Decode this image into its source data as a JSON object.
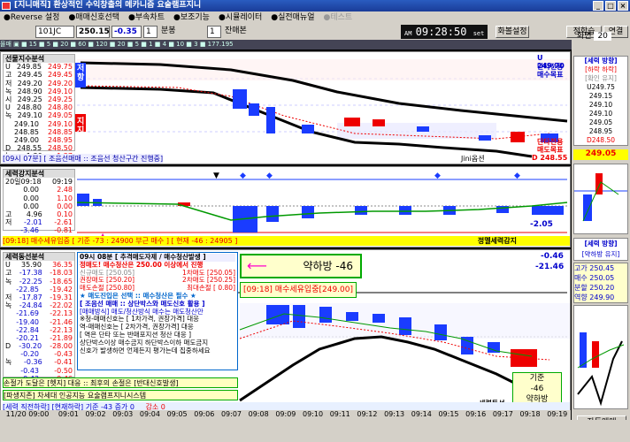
{
  "window": {
    "title": "[지니매직] 환상적인 수익창출의 메카니즘 요술램프지니",
    "min": "_",
    "max": "□",
    "close": "×"
  },
  "menu": [
    "●Reverse 설정",
    "●매매신호선택",
    "●부속차트",
    "●보조기능",
    "●시뮬레이터",
    "●실전매뉴얼",
    "●테스트"
  ],
  "toolbar": {
    "code": "101JC",
    "price": "250.15",
    "change": "-0.35",
    "period_num": "1",
    "period_unit": "분봉",
    "count": "1",
    "count_label": "잔매본",
    "clock": "09:28:50",
    "clock_suffix": "set",
    "btn_shrink": "화볼설정",
    "btn_watch": "정학습",
    "btn_link": "연결",
    "screen_label": "화면",
    "screen_num": "20"
  },
  "toolbar2": "몰매 ▣ ■ 15 ■ 5 ■ 20 ■ 60 ■ 120 ■ 20 ■ 5 ■ 1 ■ 4 ■ 10 ■ 3 ■ 177.195",
  "panel1": {
    "title": "선물지수분석",
    "rows": [
      [
        "U",
        "249.85",
        "249.75"
      ],
      [
        "고",
        "249.45",
        "249.45"
      ],
      [
        "저",
        "249.20",
        "249.20"
      ],
      [
        "녹",
        "248.90",
        "249.10"
      ],
      [
        "시",
        "249.25",
        "249.25"
      ],
      [
        "U",
        "248.80",
        "248.80"
      ],
      [
        "녹",
        "249.10",
        "249.05"
      ],
      [
        "",
        "249.10",
        "249.10"
      ],
      [
        "",
        "248.85",
        "248.85"
      ],
      [
        "",
        "249.00",
        "248.95"
      ],
      [
        "D",
        "248.55",
        "248.50"
      ],
      [
        "녹",
        "1.30",
        "1.27"
      ]
    ],
    "tag_top": "저항",
    "tag_bot": "지지",
    "label_tl": "U 249.70",
    "label_tr1": "단타전용",
    "label_tr2": "매수목표",
    "label_bl1": "단타전용",
    "label_bl2": "매도목표",
    "label_br": "D 248.55",
    "status_left": "[09시 07분] [ 조음선매매 :: 조음선 청산구간 진행중]",
    "status_right": "Jini옵션"
  },
  "panel2": {
    "title": "세력강지분석",
    "date": "20일09:18",
    "time": "09:19",
    "rows": [
      [
        "",
        "0.00",
        "2.48"
      ],
      [
        "",
        "0.00",
        "1.10"
      ],
      [
        "",
        "0.00",
        "0.00"
      ],
      [
        "고",
        "4.96",
        "0.10"
      ],
      [
        "저",
        "-2.01",
        "-2.61"
      ],
      [
        "",
        "-3.46",
        "-0.81"
      ],
      [
        "",
        "-0.59",
        "-1.01"
      ]
    ],
    "status": "[09:18] 매수세유입중 [ 기준 -73 : 24900 부근 매수 ] [ 현재 -46 : 24905 ]",
    "status_right": "정멜세력감지",
    "val": "-2.05"
  },
  "panel3": {
    "title": "세력동선분석",
    "rows": [
      [
        "U",
        "35.90",
        "36.35"
      ],
      [
        "고",
        "-17.38",
        "-18.03"
      ],
      [
        "녹",
        "-22.25",
        "-18.65"
      ],
      [
        "",
        "-22.85",
        "-19.42"
      ],
      [
        "저",
        "-17.87",
        "-19.31"
      ],
      [
        "녹",
        "-24.84",
        "-22.02"
      ],
      [
        "",
        "-21.69",
        "-22.13"
      ],
      [
        "",
        "-19.40",
        "-21.46"
      ],
      [
        "",
        "-22.84",
        "-22.13"
      ],
      [
        "",
        "-20.21",
        "-21.89"
      ],
      [
        "D",
        "-30.20",
        "-28.00"
      ],
      [
        "",
        "-0.20",
        "-0.43"
      ],
      [
        "녹",
        "-0.36",
        "-0.41"
      ],
      [
        "",
        "-0.43",
        "-0.50"
      ],
      [
        "",
        "-0.43",
        "-0.46"
      ]
    ]
  },
  "info": {
    "header": "09시 08분 [ 추격매도자제 / 매수청산발생 ]",
    "line1": "정매도! 매수청산은 250.00 이상에서 진행",
    "l2a": "신규매도 [250.05]",
    "l2b": "1차매도 [250.05]",
    "l3a": "권장매도 [250.20]",
    "l3b": "2차매도 [250.25]",
    "l4a": "매도손절 [250.80]",
    "l4b": "최대손절 [ 0.80]",
    "line5": "★ 매도진입은 선택  ::  매수청산은 필수 ★",
    "sec_title": "[ 조음선 매매 :: 상단박스와 매도신호 활용 ]",
    "s1": "[매매방식] 매도/청산방식 매수는 매도청산만",
    "s2": "※청-매매신호는 [ 1차가격, 권장가격] 대응",
    "s3": "역-매매신호는 [ 2차가격, 권장가격] 대응",
    "s4": "[ 역은 단타 또는  반매포지션 청산 대응 ]",
    "s5": "상단박스이상 매수금지  하단박스이하 매도금지",
    "s6": "신호가 발생하면 언제든지 평가는데 집중하세요",
    "foot1": "손절가 도달은 [헷지] 대응 :: 최후의 손절은 [반대신호발생]",
    "foot2": "[파생지존] 차세대 인공지능 요술램프지니시스템"
  },
  "arrow_label": "약하방 -46",
  "box_label": "[09:18] 매수세유입중[249.00]",
  "p3_vals": [
    "-0.46",
    "-21.46"
  ],
  "p3_box": [
    "기준",
    "-46",
    "약하방"
  ],
  "p3_status": "세력동선",
  "p3_bottom": "[세력 직전하락] [현재하락] 기준 -43  증가 0",
  "p3_bottom2": "감소 0",
  "times": [
    "11/20 09:00",
    "09:01",
    "09:02",
    "09:03",
    "09:04",
    "09:05",
    "09:06",
    "09:07",
    "09:08",
    "09:09",
    "09:10",
    "09:11",
    "09:12",
    "09:13",
    "09:14",
    "09:15",
    "09:16",
    "09:17",
    "09:18",
    "09:19"
  ],
  "right": {
    "sec1_title": "[세력 방향]",
    "sec1_sub": "[하락 하락]",
    "sec1_sub2": "[확인 유지]",
    "vals": [
      "U249.75",
      "249.15",
      "249.10",
      "249.10",
      "249.05",
      "248.95",
      "D248.50"
    ],
    "sec2_val": "249.05",
    "sec3_title": "[세력 방향]",
    "sec3_sub": "[약하방 유지]",
    "sec4_vals": [
      "고가 250.45",
      "매수 250.05",
      "분할 250.20",
      "역향 249.90"
    ],
    "auto_btn": "자동매매"
  },
  "colors": {
    "red": "#e00000",
    "blue": "#1a3cff",
    "panelbg": "#ffffff"
  }
}
